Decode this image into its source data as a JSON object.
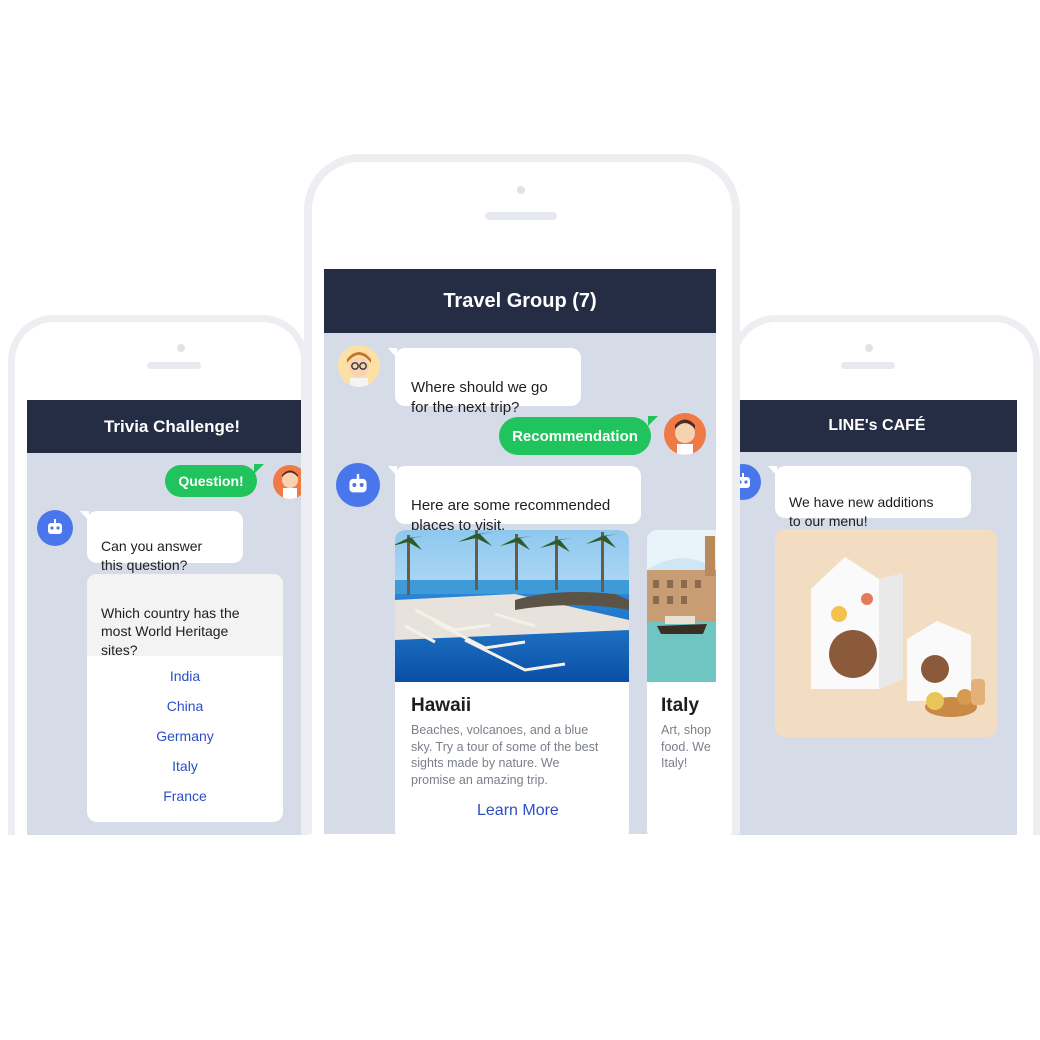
{
  "colors": {
    "header": "#252d44",
    "chat_bg": "#d6dbe8",
    "green": "#21c45c",
    "bot": "#4a76ec",
    "link": "#2b4fc5"
  },
  "left_phone": {
    "title": "Trivia Challenge!",
    "user_message": "Question!",
    "bot_message": "Can you answer\nthis question?",
    "quiz": {
      "question": "Which country has the\nmost World Heritage\nsites?",
      "options": [
        "India",
        "China",
        "Germany",
        "Italy",
        "France"
      ]
    }
  },
  "center_phone": {
    "title": "Travel Group (7)",
    "friend_message": "Where should we go\nfor the next trip?",
    "user_message": "Recommendation",
    "bot_message": "Here are some recommended\nplaces to visit.",
    "cards": [
      {
        "title": "Hawaii",
        "description": "Beaches, volcanoes, and a blue\nsky. Try a tour of some of the best\nsights made by nature. We\npromise an amazing trip.",
        "link": "Learn More"
      },
      {
        "title": "Italy",
        "description": "Art, shop\nfood. We\nItaly!"
      }
    ]
  },
  "right_phone": {
    "title": "LINE's CAFÉ",
    "bot_message": "We have new additions\nto our menu!"
  },
  "icons": {
    "bot": "robot-icon",
    "user": "user-avatar",
    "friend": "friend-avatar-glasses",
    "product": "cafe-product-image"
  }
}
